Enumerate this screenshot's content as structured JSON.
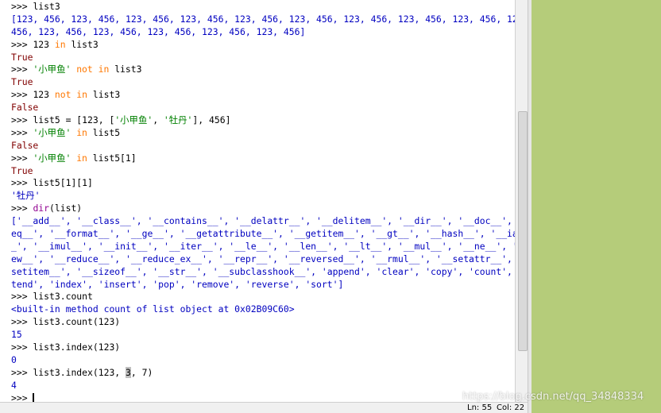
{
  "shell": {
    "lines": [
      [
        {
          "t": ">>> ",
          "c": "prompt"
        },
        {
          "t": "list3",
          "c": "code"
        }
      ],
      [
        {
          "t": "[123, 456, 123, 456, 123, 456, 123, 456, 123, 456, 123, 456, 123, 456, 123, 456, 123, 456, 123,",
          "c": "out"
        }
      ],
      [
        {
          "t": "456, 123, 456, 123, 456, 123, 456, 123, 456, 123, 456]",
          "c": "out"
        }
      ],
      [
        {
          "t": ">>> ",
          "c": "prompt"
        },
        {
          "t": "123 ",
          "c": "code"
        },
        {
          "t": "in",
          "c": "kw"
        },
        {
          "t": " list3",
          "c": "code"
        }
      ],
      [
        {
          "t": "True",
          "c": "bool"
        }
      ],
      [
        {
          "t": ">>> ",
          "c": "prompt"
        },
        {
          "t": "'小甲鱼'",
          "c": "str"
        },
        {
          "t": " ",
          "c": "code"
        },
        {
          "t": "not in",
          "c": "kw"
        },
        {
          "t": " list3",
          "c": "code"
        }
      ],
      [
        {
          "t": "True",
          "c": "bool"
        }
      ],
      [
        {
          "t": ">>> ",
          "c": "prompt"
        },
        {
          "t": "123 ",
          "c": "code"
        },
        {
          "t": "not in",
          "c": "kw"
        },
        {
          "t": " list3",
          "c": "code"
        }
      ],
      [
        {
          "t": "False",
          "c": "bool"
        }
      ],
      [
        {
          "t": ">>> ",
          "c": "prompt"
        },
        {
          "t": "list5 = [123, [",
          "c": "code"
        },
        {
          "t": "'小甲鱼'",
          "c": "str"
        },
        {
          "t": ", ",
          "c": "code"
        },
        {
          "t": "'牡丹'",
          "c": "str"
        },
        {
          "t": "], 456]",
          "c": "code"
        }
      ],
      [
        {
          "t": ">>> ",
          "c": "prompt"
        },
        {
          "t": "'小甲鱼'",
          "c": "str"
        },
        {
          "t": " ",
          "c": "code"
        },
        {
          "t": "in",
          "c": "kw"
        },
        {
          "t": " list5",
          "c": "code"
        }
      ],
      [
        {
          "t": "False",
          "c": "bool"
        }
      ],
      [
        {
          "t": ">>> ",
          "c": "prompt"
        },
        {
          "t": "'小甲鱼'",
          "c": "str"
        },
        {
          "t": " ",
          "c": "code"
        },
        {
          "t": "in",
          "c": "kw"
        },
        {
          "t": " list5[1]",
          "c": "code"
        }
      ],
      [
        {
          "t": "True",
          "c": "bool"
        }
      ],
      [
        {
          "t": ">>> ",
          "c": "prompt"
        },
        {
          "t": "list5[1][1]",
          "c": "code"
        }
      ],
      [
        {
          "t": "'牡丹'",
          "c": "out"
        }
      ],
      [
        {
          "t": ">>> ",
          "c": "prompt"
        },
        {
          "t": "dir",
          "c": "builtin"
        },
        {
          "t": "(list)",
          "c": "code"
        }
      ],
      [
        {
          "t": "['__add__', '__class__', '__contains__', '__delattr__', '__delitem__', '__dir__', '__doc__', '__",
          "c": "out"
        }
      ],
      [
        {
          "t": "eq__', '__format__', '__ge__', '__getattribute__', '__getitem__', '__gt__', '__hash__', '__iadd_",
          "c": "out"
        }
      ],
      [
        {
          "t": "_', '__imul__', '__init__', '__iter__', '__le__', '__len__', '__lt__', '__mul__', '__ne__', '__n",
          "c": "out"
        }
      ],
      [
        {
          "t": "ew__', '__reduce__', '__reduce_ex__', '__repr__', '__reversed__', '__rmul__', '__setattr__', '__",
          "c": "out"
        }
      ],
      [
        {
          "t": "setitem__', '__sizeof__', '__str__', '__subclasshook__', 'append', 'clear', 'copy', 'count', 'ex",
          "c": "out"
        }
      ],
      [
        {
          "t": "tend', 'index', 'insert', 'pop', 'remove', 'reverse', 'sort']",
          "c": "out"
        }
      ],
      [
        {
          "t": ">>> ",
          "c": "prompt"
        },
        {
          "t": "list3.count",
          "c": "code"
        }
      ],
      [
        {
          "t": "<built-in method count of list object at 0x02B09C60>",
          "c": "out"
        }
      ],
      [
        {
          "t": ">>> ",
          "c": "prompt"
        },
        {
          "t": "list3.count(123)",
          "c": "code"
        }
      ],
      [
        {
          "t": "15",
          "c": "out"
        }
      ],
      [
        {
          "t": ">>> ",
          "c": "prompt"
        },
        {
          "t": "list3.index(123)",
          "c": "code"
        }
      ],
      [
        {
          "t": "0",
          "c": "out"
        }
      ],
      [
        {
          "t": ">>> ",
          "c": "prompt"
        },
        {
          "t": "list3.index(123, ",
          "c": "code"
        },
        {
          "t": "3",
          "c": "code hl"
        },
        {
          "t": ", 7)",
          "c": "code"
        }
      ],
      [
        {
          "t": "4",
          "c": "out"
        }
      ],
      [
        {
          "t": ">>> ",
          "c": "prompt"
        }
      ]
    ]
  },
  "status": {
    "line": "Ln: 55",
    "col": "Col: 22"
  },
  "watermark": "https://blog.csdn.net/qq_34848334",
  "colors": {
    "output": "#0000c0",
    "boolean": "#800000",
    "string": "#008000",
    "keyword": "#ff7700",
    "builtin": "#900090",
    "desktop": "#b5cc7a"
  }
}
